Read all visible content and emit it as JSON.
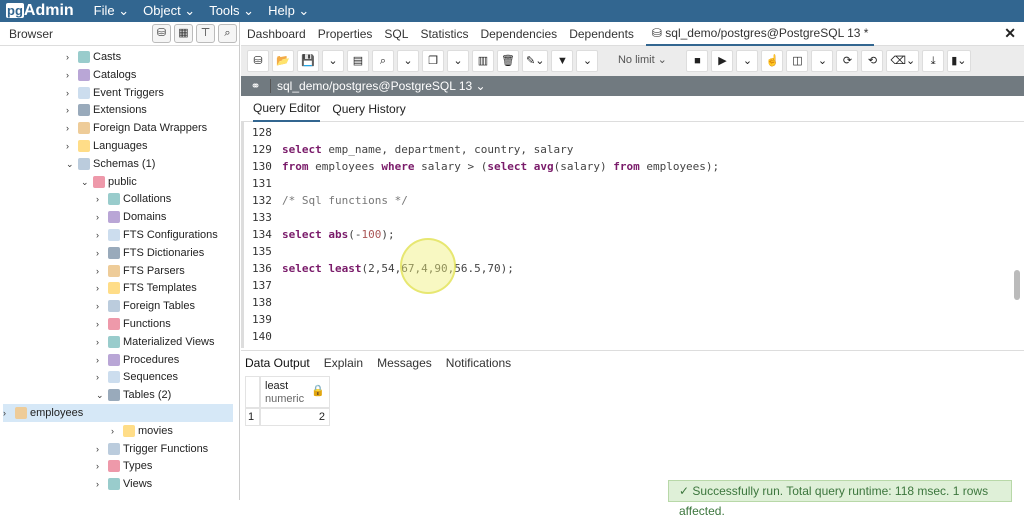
{
  "app": {
    "logo": "pgAdmin",
    "menus": [
      "File ⌄",
      "Object ⌄",
      "Tools ⌄",
      "Help ⌄"
    ]
  },
  "browser": {
    "title": "Browser",
    "items": [
      {
        "label": "Casts",
        "icon": "casts-icon",
        "chev": "›"
      },
      {
        "label": "Catalogs",
        "icon": "catalogs-icon",
        "chev": "›"
      },
      {
        "label": "Event Triggers",
        "icon": "event-triggers-icon",
        "chev": "›"
      },
      {
        "label": "Extensions",
        "icon": "extensions-icon",
        "chev": "›"
      },
      {
        "label": "Foreign Data Wrappers",
        "icon": "fdw-icon",
        "chev": "›"
      },
      {
        "label": "Languages",
        "icon": "languages-icon",
        "chev": "›"
      },
      {
        "label": "Schemas (1)",
        "icon": "schemas-icon",
        "chev": "⌄"
      },
      {
        "label": "public",
        "icon": "schema-icon",
        "chev": "⌄"
      },
      {
        "label": "Collations",
        "icon": "collations-icon",
        "chev": "›"
      },
      {
        "label": "Domains",
        "icon": "domains-icon",
        "chev": "›"
      },
      {
        "label": "FTS Configurations",
        "icon": "fts-config-icon",
        "chev": "›"
      },
      {
        "label": "FTS Dictionaries",
        "icon": "fts-dict-icon",
        "chev": "›"
      },
      {
        "label": "FTS Parsers",
        "icon": "fts-parsers-icon",
        "chev": "›"
      },
      {
        "label": "FTS Templates",
        "icon": "fts-templates-icon",
        "chev": "›"
      },
      {
        "label": "Foreign Tables",
        "icon": "foreign-tables-icon",
        "chev": "›"
      },
      {
        "label": "Functions",
        "icon": "functions-icon",
        "chev": "›"
      },
      {
        "label": "Materialized Views",
        "icon": "mat-views-icon",
        "chev": "›"
      },
      {
        "label": "Procedures",
        "icon": "procedures-icon",
        "chev": "›"
      },
      {
        "label": "Sequences",
        "icon": "sequences-icon",
        "chev": "›"
      },
      {
        "label": "Tables (2)",
        "icon": "tables-icon",
        "chev": "⌄"
      },
      {
        "label": "employees",
        "icon": "table-icon",
        "chev": "›"
      },
      {
        "label": "movies",
        "icon": "table-icon",
        "chev": "›"
      },
      {
        "label": "Trigger Functions",
        "icon": "trigger-functions-icon",
        "chev": "›"
      },
      {
        "label": "Types",
        "icon": "types-icon",
        "chev": "›"
      },
      {
        "label": "Views",
        "icon": "views-icon",
        "chev": "›"
      }
    ]
  },
  "tabs": [
    "Dashboard",
    "Properties",
    "SQL",
    "Statistics",
    "Dependencies",
    "Dependents",
    "sql_demo/postgres@PostgreSQL 13 *"
  ],
  "toolbar": {
    "limit": "No limit"
  },
  "connection": "sql_demo/postgres@PostgreSQL 13 ⌄",
  "query_tabs": [
    "Query Editor",
    "Query History"
  ],
  "editor": {
    "line_numbers": [
      "128",
      "129",
      "130",
      "131",
      "132",
      "133",
      "134",
      "135",
      "136",
      "137",
      "138",
      "139",
      "140"
    ]
  },
  "output_tabs": [
    "Data Output",
    "Explain",
    "Messages",
    "Notifications"
  ],
  "grid": {
    "column": "least",
    "type": "numeric",
    "row_number": "1",
    "value": "2"
  },
  "status": "✓  Successfully run. Total query runtime: 118 msec. 1 rows affected.",
  "colors": {
    "header": "#326690",
    "selected": "#d6e8f7"
  }
}
